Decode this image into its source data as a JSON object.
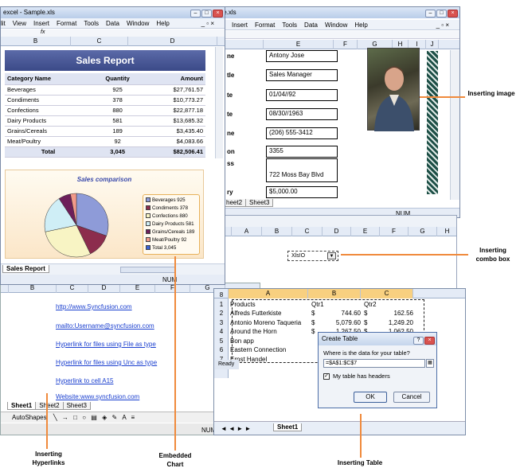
{
  "win1": {
    "title": "excel - Sample.xls",
    "menu": [
      "lit",
      "View",
      "Insert",
      "Format",
      "Tools",
      "Data",
      "Window",
      "Help"
    ],
    "fx": "fx",
    "cols": [
      "B",
      "C",
      "D"
    ],
    "report": {
      "title": "Sales Report",
      "headers": [
        "Category Name",
        "Quantity",
        "Amount"
      ],
      "rows": [
        [
          "Beverages",
          "925",
          "$27,761.57"
        ],
        [
          "Condiments",
          "378",
          "$10,773.27"
        ],
        [
          "Confections",
          "880",
          "$22,877.18"
        ],
        [
          "Dairy Products",
          "581",
          "$13,685.32"
        ],
        [
          "Grains/Cereals",
          "189",
          "$3,435.40"
        ],
        [
          "Meat/Poultry",
          "92",
          "$4,083.66"
        ]
      ],
      "total": [
        "Total",
        "3,045",
        "$82,506.41"
      ]
    },
    "sheet_tab": "Sales Report",
    "status": "NUM"
  },
  "chart_data": {
    "type": "pie",
    "title": "Sales comparison",
    "categories": [
      "Beverages",
      "Condiments",
      "Confections",
      "Dairy Products",
      "Grains/Cereals",
      "Meat/Poultry"
    ],
    "values": [
      925,
      378,
      880,
      581,
      189,
      92
    ],
    "legend": [
      "Beverages 925",
      "Condiments 378",
      "Confections 880",
      "Dairy Products 581",
      "Grains/Cereals 189",
      "Meat/Poultry 92",
      "Total 3,045"
    ],
    "colors": [
      "#8e9bd8",
      "#8c2d4d",
      "#f8f4c4",
      "#cfeef6",
      "#6d1f5a",
      "#f29a8a",
      "#3c62d4"
    ]
  },
  "win2": {
    "title": "ple.xls",
    "menu": [
      "Insert",
      "Format",
      "Tools",
      "Data",
      "Window",
      "Help"
    ],
    "cols": [
      "E",
      "F",
      "G",
      "H",
      "I",
      "J"
    ],
    "labels": [
      "ne",
      "tle",
      "te",
      "te",
      "ne",
      "on",
      "ss",
      "ry"
    ],
    "values": [
      "Antony Jose",
      "Sales Manager",
      "01/04//92",
      "08/30//1963",
      "(206) 555-3412",
      "3355",
      "722 Moss Bay Blvd",
      "$5,000.00"
    ],
    "tabs": [
      "heet2",
      "Sheet3"
    ],
    "status": "NUM"
  },
  "win3": {
    "cols": [
      "A",
      "B",
      "C",
      "D",
      "E",
      "F",
      "G",
      "H"
    ],
    "combo_text": "Xls!O"
  },
  "win4": {
    "tabs": [
      "Sheet1",
      "Sheet2",
      "Sheet3"
    ],
    "links": [
      "http://www.Syncfusion.com",
      "mailto:Username@syncfusion.com",
      "Hyperlink for files using File as type",
      "Hyperlink for files using Unc as type",
      "Hyperlink to cell A15",
      "Website:www.syncfusion.com"
    ],
    "cols": [
      "B",
      "C",
      "D",
      "E",
      "F",
      "G"
    ],
    "autoshapes": "AutoShapes",
    "status": "NUM"
  },
  "win5": {
    "cols": [
      "A",
      "B",
      "C"
    ],
    "row_nums": [
      "8",
      "1",
      "2",
      "3",
      "4",
      "5",
      "6",
      "7",
      "8"
    ],
    "headers": [
      "Products",
      "Qtr1",
      "Qtr2"
    ],
    "rows": [
      [
        "Alfreds Futterkiste",
        "$",
        "744.60",
        "$",
        "162.56"
      ],
      [
        "Antonio Moreno Taqueria",
        "$",
        "5,079.60",
        "$",
        "1,249.20"
      ],
      [
        "Around the Horn",
        "$",
        "1,267.50",
        "$",
        "1,062.50"
      ],
      [
        "Bon app",
        "",
        "",
        "",
        ""
      ],
      [
        "Eastern Connection",
        "",
        "",
        "",
        ""
      ],
      [
        "Ernst Handel",
        "",
        "",
        "",
        ""
      ]
    ],
    "sheet_tab": "Sheet1",
    "status": "Ready"
  },
  "dialog": {
    "title": "Create Table",
    "question": "Where is the data for your table?",
    "range": "=$A$1:$C$7",
    "checkbox": "My table has headers",
    "ok": "OK",
    "cancel": "Cancel"
  },
  "callouts": {
    "image": "Inserting image",
    "combo": "Inserting combo box",
    "hyperlinks": "Inserting Hyperlinks",
    "chart": "Embedded Chart",
    "table": "Inserting Table"
  }
}
